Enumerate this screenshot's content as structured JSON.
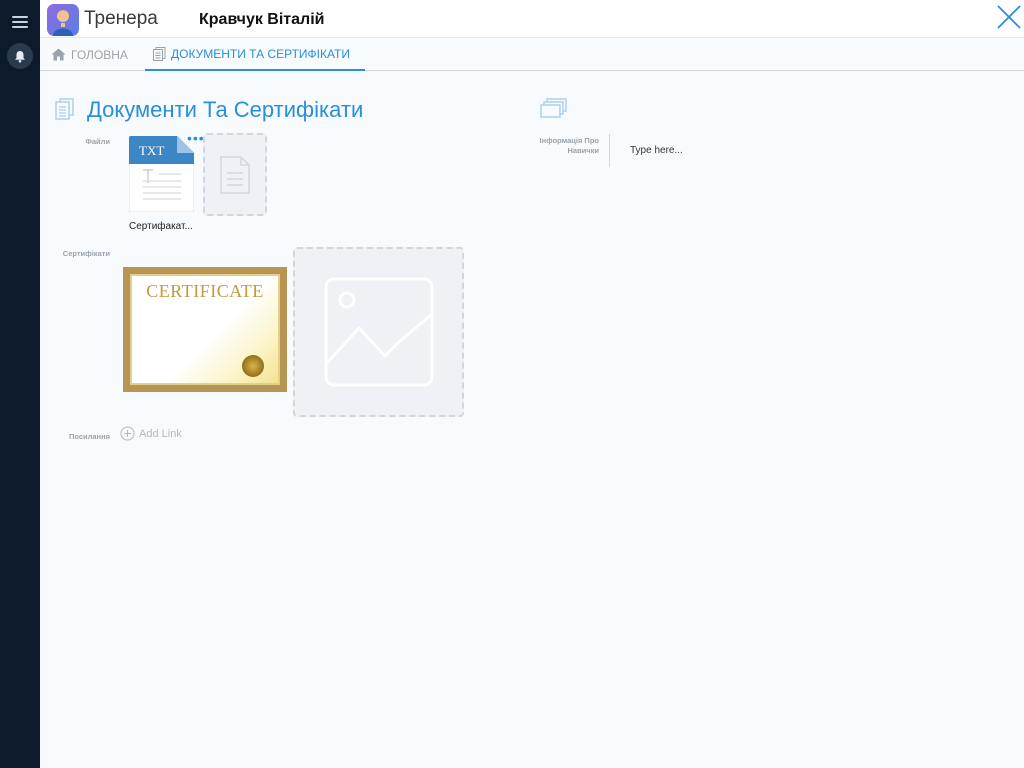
{
  "header": {
    "app_title": "Тренера",
    "user_name": "Кравчук Віталій"
  },
  "tabs": [
    {
      "label": "ГОЛОВНА",
      "icon": "home-icon",
      "active": false
    },
    {
      "label": "ДОКУМЕНТИ ТА СЕРТИФІКАТИ",
      "icon": "document-icon",
      "active": true
    }
  ],
  "section": {
    "title": "Документи Та Сертифікати"
  },
  "files": {
    "label": "Файли",
    "items": [
      {
        "type_badge": "TXT",
        "name": "Сертифакат..."
      }
    ]
  },
  "certificates": {
    "label": "Сертифікати",
    "items": [
      {
        "title": "CERTIFICATE"
      }
    ]
  },
  "links": {
    "label": "Посилання",
    "add_label": "Add Link"
  },
  "info": {
    "label": "Інформація Про Навички",
    "placeholder": "Type here..."
  },
  "colors": {
    "accent": "#2a8fd6",
    "rail": "#0d1a2b"
  }
}
